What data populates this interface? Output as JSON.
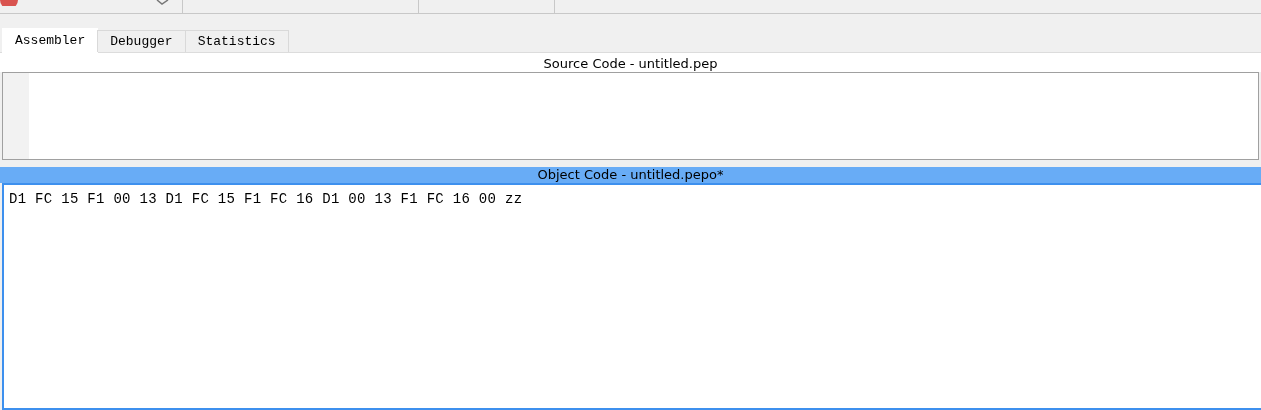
{
  "tabs": [
    {
      "label": "Assembler",
      "selected": true
    },
    {
      "label": "Debugger",
      "selected": false
    },
    {
      "label": "Statistics",
      "selected": false
    }
  ],
  "panes": [
    {
      "title": "Source Code - untitled.pep",
      "focused": false,
      "kind": "source"
    },
    {
      "title": "Object Code - untitled.pepo*",
      "focused": true,
      "kind": "object",
      "content": "D1 FC 15 F1 00 13 D1 FC 15 F1 FC 16 D1 00 13 F1 FC 16 00 zz"
    }
  ]
}
